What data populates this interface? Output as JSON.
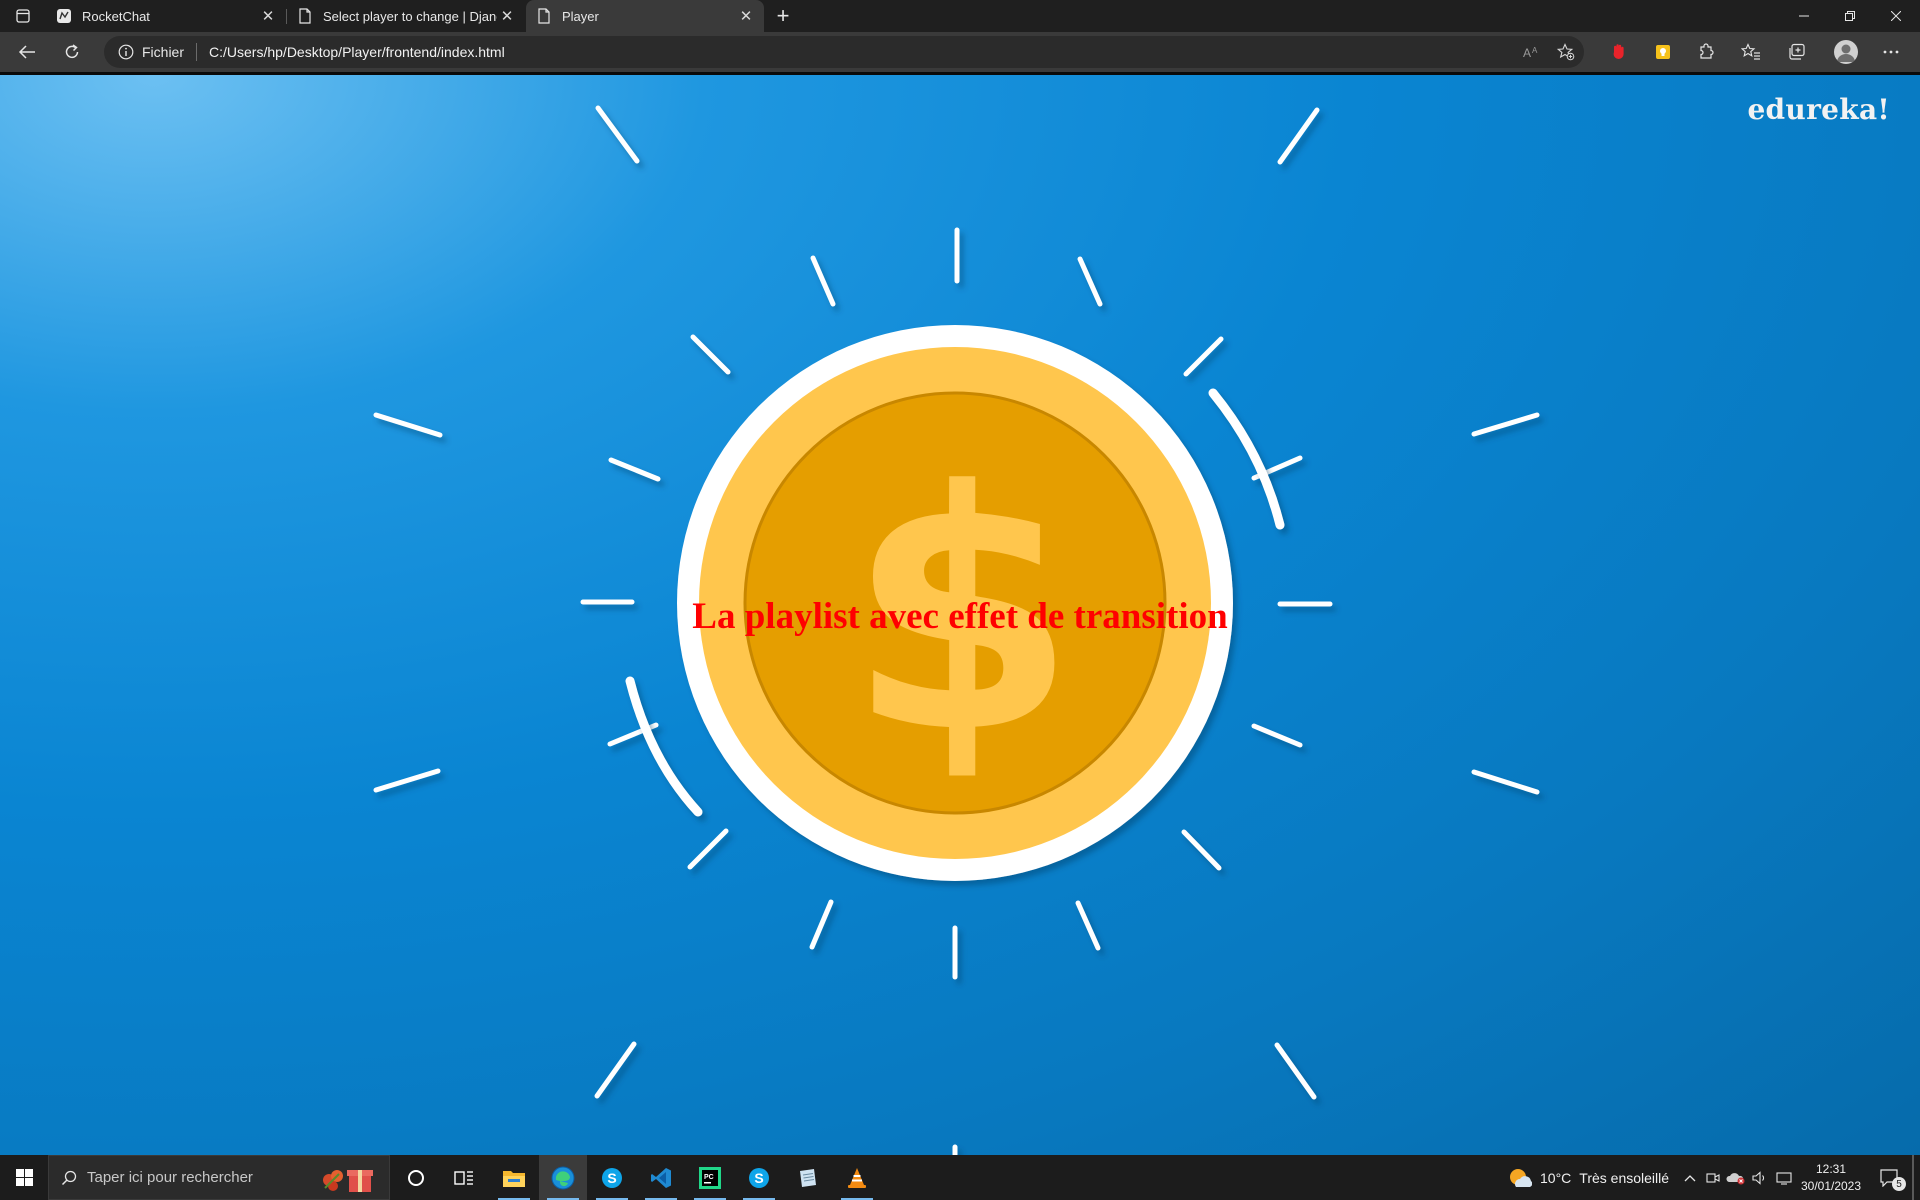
{
  "browser": {
    "tabs": [
      {
        "title": "RocketChat",
        "icon": "rocketchat-icon",
        "active": false
      },
      {
        "title": "Select player to change | Django",
        "icon": "page-icon",
        "active": false
      },
      {
        "title": "Player",
        "icon": "page-icon",
        "active": true
      }
    ],
    "address": {
      "scheme_label": "Fichier",
      "url": "C:/Users/hp/Desktop/Player/frontend/index.html"
    }
  },
  "page": {
    "heading": "La playlist avec effet de transition",
    "video_watermark": "edureka!",
    "video_frame": "coin-with-dollar-sign",
    "colors": {
      "heading": "#ff0000",
      "background": "#0a85d2",
      "coin_outer": "#ffc64d",
      "coin_inner": "#e59e00"
    }
  },
  "taskbar": {
    "search_placeholder": "Taper ici pour rechercher",
    "apps": [
      "cortana-icon",
      "task-view-icon",
      "file-explorer-icon",
      "edge-icon",
      "skype-icon",
      "vscode-icon",
      "pycharm-icon",
      "skype-icon",
      "notepad-icon",
      "vlc-icon"
    ],
    "weather": {
      "temp": "10°C",
      "condition": "Très ensoleillé"
    },
    "time": "12:31",
    "date": "30/01/2023",
    "notifications": "5"
  }
}
